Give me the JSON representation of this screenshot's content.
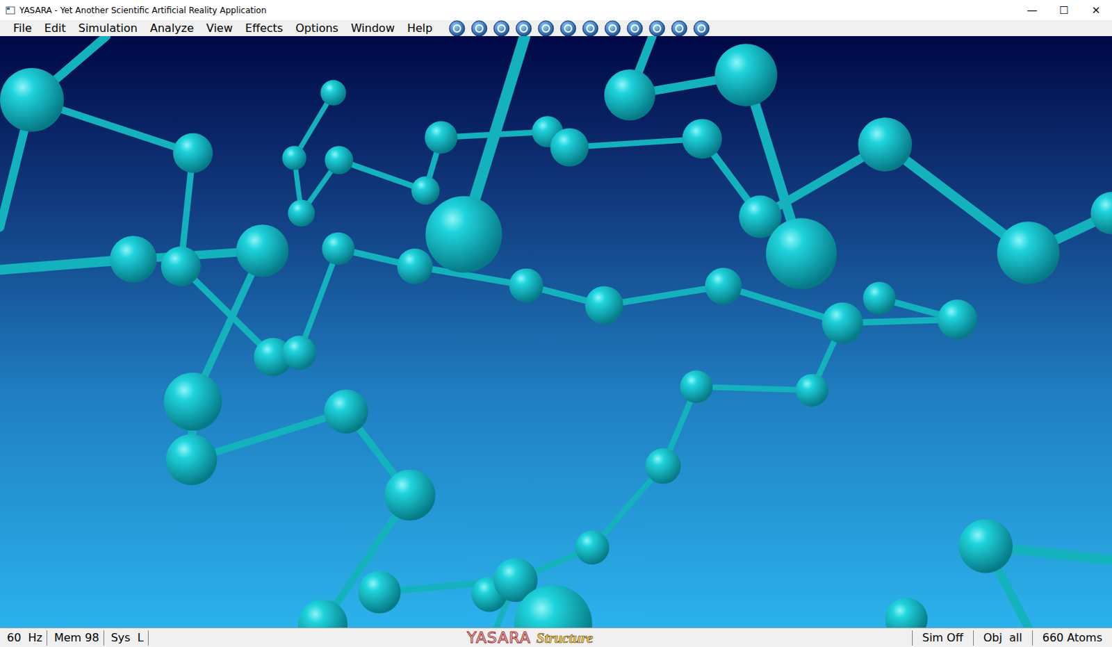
{
  "window": {
    "title": "YASARA - Yet Another Scientific Artificial Reality Application",
    "controls": [
      "—",
      "☐",
      "✕"
    ]
  },
  "menu": [
    "File",
    "Edit",
    "Simulation",
    "Analyze",
    "View",
    "Effects",
    "Options",
    "Window",
    "Help"
  ],
  "status_bar": {
    "left": [
      "60  Hz",
      "Mem 98",
      "Sys  L"
    ],
    "logo": {
      "name": "YASARA",
      "edition": "Structure"
    },
    "right": [
      "Sim Off",
      "Obj  all",
      "660 Atoms"
    ]
  }
}
